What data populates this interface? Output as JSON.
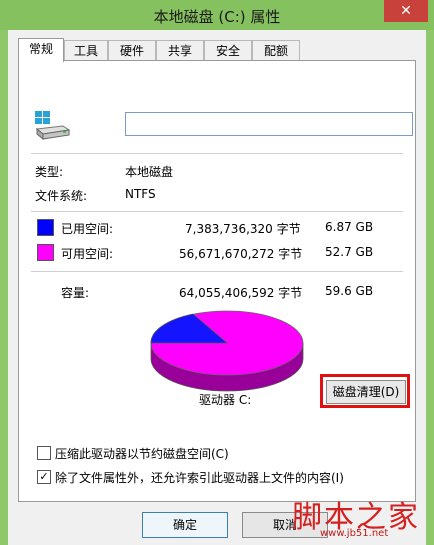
{
  "window": {
    "title": "本地磁盘 (C:) 属性",
    "close_glyph": "✕"
  },
  "tabs": [
    {
      "label": "常规",
      "active": true
    },
    {
      "label": "工具",
      "active": false
    },
    {
      "label": "硬件",
      "active": false
    },
    {
      "label": "共享",
      "active": false
    },
    {
      "label": "安全",
      "active": false
    },
    {
      "label": "配额",
      "active": false
    }
  ],
  "general": {
    "drive_icon": "drive-icon",
    "name_value": "",
    "type_label": "类型:",
    "type_value": "本地磁盘",
    "fs_label": "文件系统:",
    "fs_value": "NTFS",
    "used": {
      "label": "已用空间:",
      "bytes": "7,383,736,320 字节",
      "size": "6.87 GB",
      "color": "#0000ff"
    },
    "free": {
      "label": "可用空间:",
      "bytes": "56,671,670,272 字节",
      "size": "52.7 GB",
      "color": "#ff00ff"
    },
    "capacity": {
      "label": "容量:",
      "bytes": "64,055,406,592 字节",
      "size": "59.6 GB"
    },
    "drive_label": "驱动器 C:",
    "cleanup_button": "磁盘清理(D)",
    "compress_checkbox": {
      "label": "压缩此驱动器以节约磁盘空间(C)",
      "checked": false
    },
    "index_checkbox": {
      "label": "除了文件属性外，还允许索引此驱动器上文件的内容(I)",
      "checked": true
    }
  },
  "buttons": {
    "ok": "确定",
    "cancel": "取消"
  },
  "watermark": {
    "text": "脚本之家",
    "url": "www.jb51.net"
  }
}
